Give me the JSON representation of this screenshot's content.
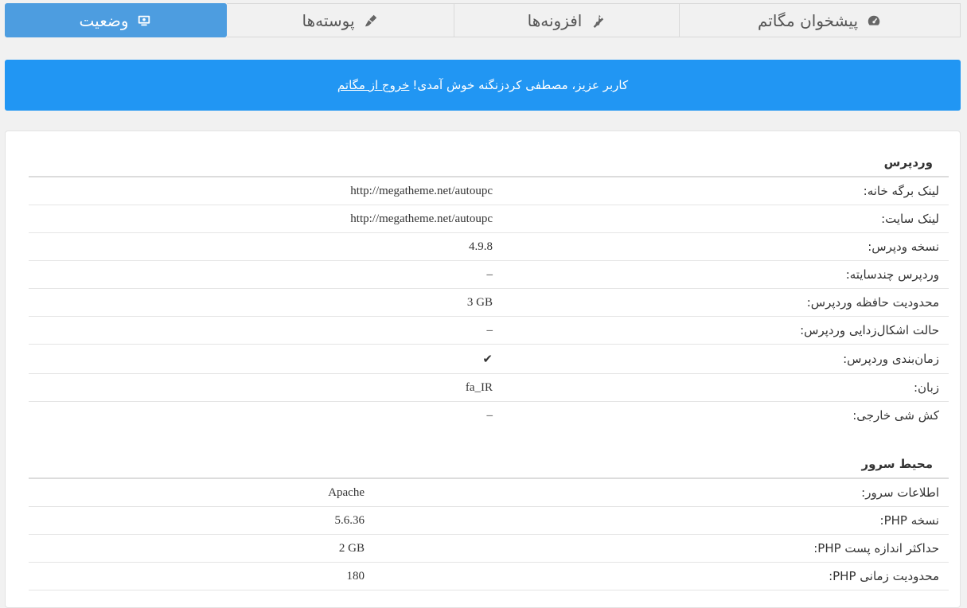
{
  "tabs": [
    {
      "label": "پیشخوان مگاتم",
      "icon": "dashboard-icon",
      "active": false
    },
    {
      "label": "افزونه‌ها",
      "icon": "plugin-icon",
      "active": false
    },
    {
      "label": "پوسته‌ها",
      "icon": "brush-icon",
      "active": false
    },
    {
      "label": "وضعیت",
      "icon": "monitor-icon",
      "active": true
    }
  ],
  "notice": {
    "text": "کاربر عزیز، مصطفی کردزنگنه خوش آمدی!",
    "link": "خروج از مگاتم"
  },
  "wordpress": {
    "title": "وردپرس",
    "rows": [
      {
        "label": "لینک برگه خانه:",
        "value": "http://megatheme.net/autoupc"
      },
      {
        "label": "لینک سایت:",
        "value": "http://megatheme.net/autoupc"
      },
      {
        "label": "نسخه ودپرس:",
        "value": "4.9.8"
      },
      {
        "label": "وردپرس چندسایته:",
        "value": "–"
      },
      {
        "label": "محدودیت حافظه وردپرس:",
        "value": "3 GB"
      },
      {
        "label": "حالت اشکال‌زدایی وردپرس:",
        "value": "–"
      },
      {
        "label": "زمان‌بندی وردپرس:",
        "value": "✔"
      },
      {
        "label": "زبان:",
        "value": "fa_IR"
      },
      {
        "label": "کش شی خارجی:",
        "value": "–"
      }
    ]
  },
  "server": {
    "title": "محیط سرور",
    "rows": [
      {
        "label": "اطلاعات سرور:",
        "value": "Apache"
      },
      {
        "label": "نسخه PHP:",
        "value": "5.6.36"
      },
      {
        "label": "حداکثر اندازه پست PHP:",
        "value": "2 GB"
      },
      {
        "label": "محدودیت زمانی PHP:",
        "value": "180"
      }
    ]
  }
}
